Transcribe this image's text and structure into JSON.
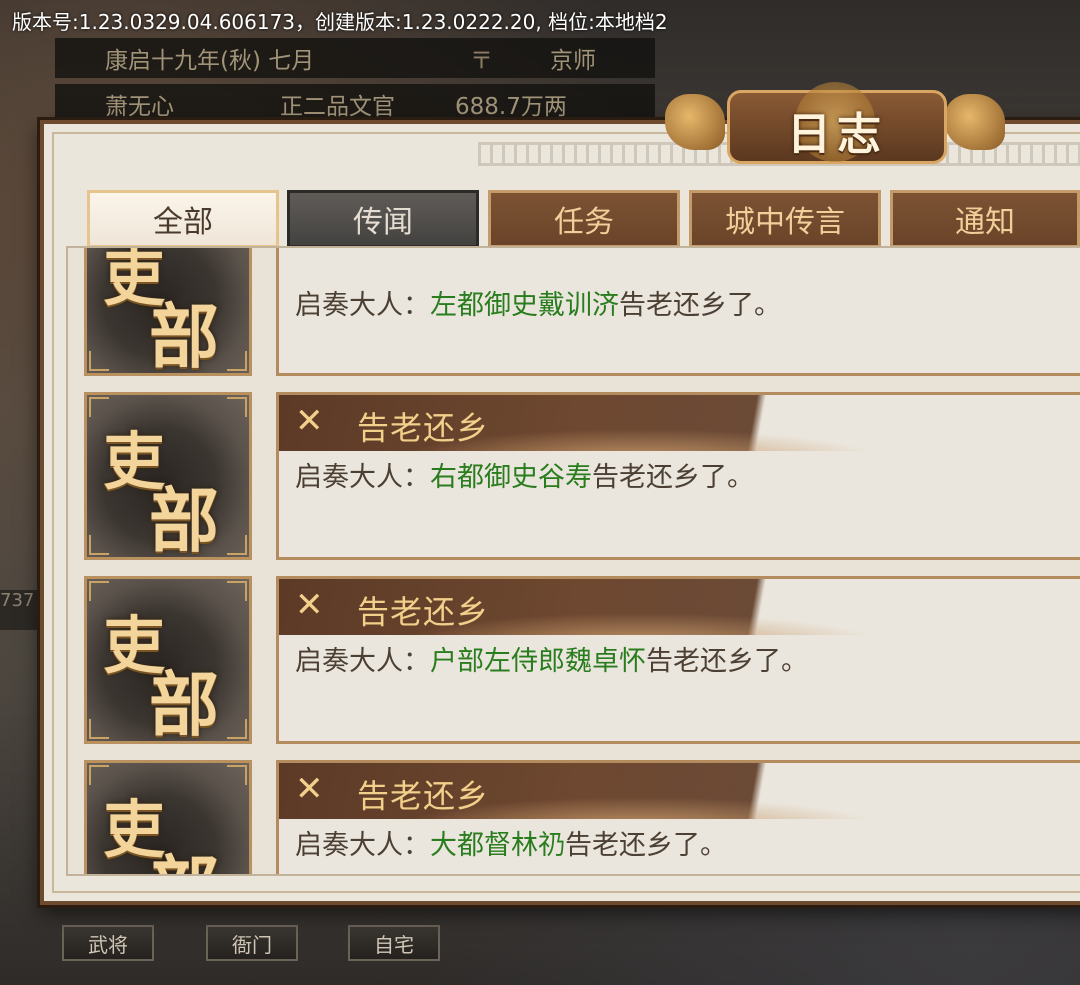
{
  "version_bar": "版本号:1.23.0329.04.606173，创建版本:1.23.0222.20, 档位:本地档2",
  "background": {
    "date": "康启十九年(秋) 七月",
    "location": "京师",
    "name": "萧无心",
    "rank": "正二品文官",
    "money": "688.7万两",
    "side_number": "737",
    "bottom_buttons": [
      "武将",
      "衙门",
      "自宅"
    ]
  },
  "dialog": {
    "title": "日志",
    "tabs": [
      {
        "label": "全部",
        "state": "active"
      },
      {
        "label": "传闻",
        "state": "dark"
      },
      {
        "label": "任务",
        "state": "normal"
      },
      {
        "label": "城中传言",
        "state": "normal"
      },
      {
        "label": "通知",
        "state": "normal"
      }
    ],
    "entries": [
      {
        "emblem_chars": [
          "吏",
          "部"
        ],
        "title": "",
        "prefix": "启奏大人：",
        "highlight": "左都御史戴训济",
        "suffix": "告老还乡了。"
      },
      {
        "emblem_chars": [
          "吏",
          "部"
        ],
        "title": "告老还乡",
        "prefix": "启奏大人：",
        "highlight": "右都御史谷寿",
        "suffix": "告老还乡了。"
      },
      {
        "emblem_chars": [
          "吏",
          "部"
        ],
        "title": "告老还乡",
        "prefix": "启奏大人：",
        "highlight": "户部左侍郎魏卓怀",
        "suffix": "告老还乡了。"
      },
      {
        "emblem_chars": [
          "吏",
          "部"
        ],
        "title": "告老还乡",
        "prefix": "启奏大人：",
        "highlight": "大都督林礽",
        "suffix": "告老还乡了。"
      }
    ],
    "entry_icon": "crossed-swords-icon",
    "highlight_color": "#2a7d1e"
  }
}
